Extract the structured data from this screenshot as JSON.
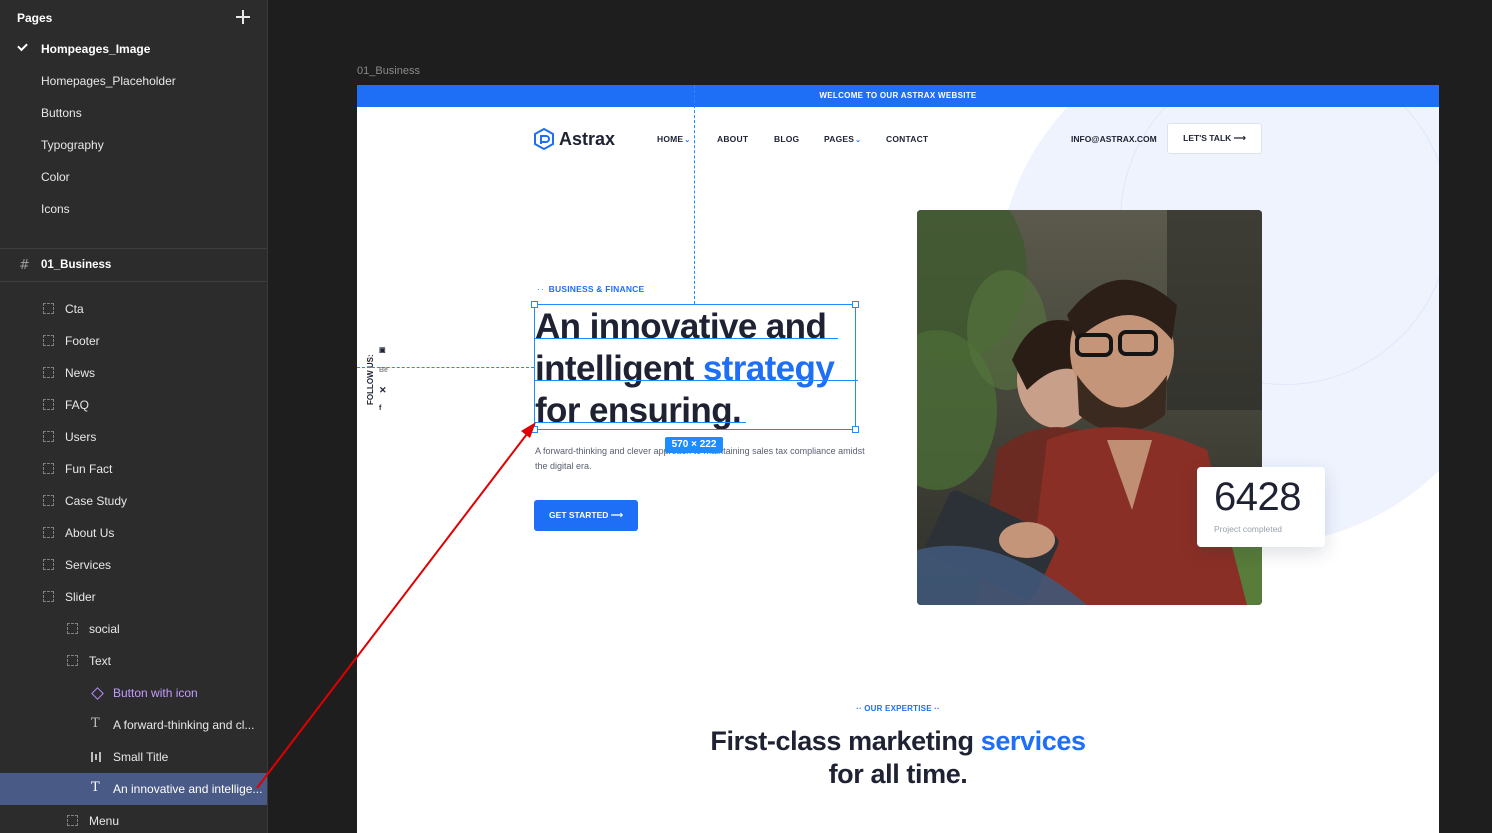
{
  "panel": {
    "title": "Pages",
    "pages": [
      {
        "label": "Hompeages_Image",
        "active": true
      },
      {
        "label": "Homepages_Placeholder"
      },
      {
        "label": "Buttons"
      },
      {
        "label": "Typography"
      },
      {
        "label": "Color"
      },
      {
        "label": "Icons"
      }
    ],
    "frame": "01_Business",
    "layers": [
      {
        "label": "Cta",
        "icon": "frame-icon"
      },
      {
        "label": "Footer",
        "icon": "frame-icon"
      },
      {
        "label": "News",
        "icon": "frame-icon"
      },
      {
        "label": "FAQ",
        "icon": "frame-icon"
      },
      {
        "label": "Users",
        "icon": "frame-icon"
      },
      {
        "label": "Fun Fact",
        "icon": "frame-icon"
      },
      {
        "label": "Case Study",
        "icon": "frame-icon"
      },
      {
        "label": "About Us",
        "icon": "frame-icon"
      },
      {
        "label": "Services",
        "icon": "frame-icon"
      },
      {
        "label": "Slider",
        "icon": "frame-icon"
      },
      {
        "label": "social",
        "icon": "frame-icon"
      },
      {
        "label": "Text",
        "icon": "frame-icon"
      },
      {
        "label": "Button with icon",
        "icon": "component-icon"
      },
      {
        "label": "A forward-thinking and cl...",
        "icon": "text-icon"
      },
      {
        "label": "Small Title",
        "icon": "bars-icon"
      },
      {
        "label": "An innovative and intellige...",
        "icon": "text-icon",
        "selected": true
      },
      {
        "label": "Menu",
        "icon": "frame-icon"
      }
    ]
  },
  "canvas": {
    "frame_label": "01_Business",
    "selection_size": "570 × 222"
  },
  "site": {
    "topbar": "WELCOME TO OUR ASTRAX WEBSITE",
    "logo": "Astrax",
    "nav": [
      "HOME",
      "ABOUT",
      "BLOG",
      "PAGES",
      "CONTACT"
    ],
    "email": "INFO@ASTRAX.COM",
    "talk_button": "LET'S TALK",
    "small_title": "BUSINESS & FINANCE",
    "headline_1": "An innovative and",
    "headline_2": "intelligent",
    "headline_highlight": "strategy",
    "headline_3": "for ensuring.",
    "description": "A forward-thinking and clever approach to maintaining sales tax compliance amidst the digital era.",
    "cta": "GET STARTED",
    "follow": "FOLLOW US:",
    "stat_value": "6428",
    "stat_label": "Project completed",
    "expertise_tag": "OUR EXPERTISE",
    "expertise_title_1": "First-class marketing",
    "expertise_highlight": "services",
    "expertise_title_2": "for all time."
  },
  "colors": {
    "accent": "#1e6ff5",
    "panel_bg": "#2c2c2c",
    "canvas_bg": "#1e1e1e",
    "selection": "#1e8cff",
    "annotation_arrow": "#e00000"
  }
}
